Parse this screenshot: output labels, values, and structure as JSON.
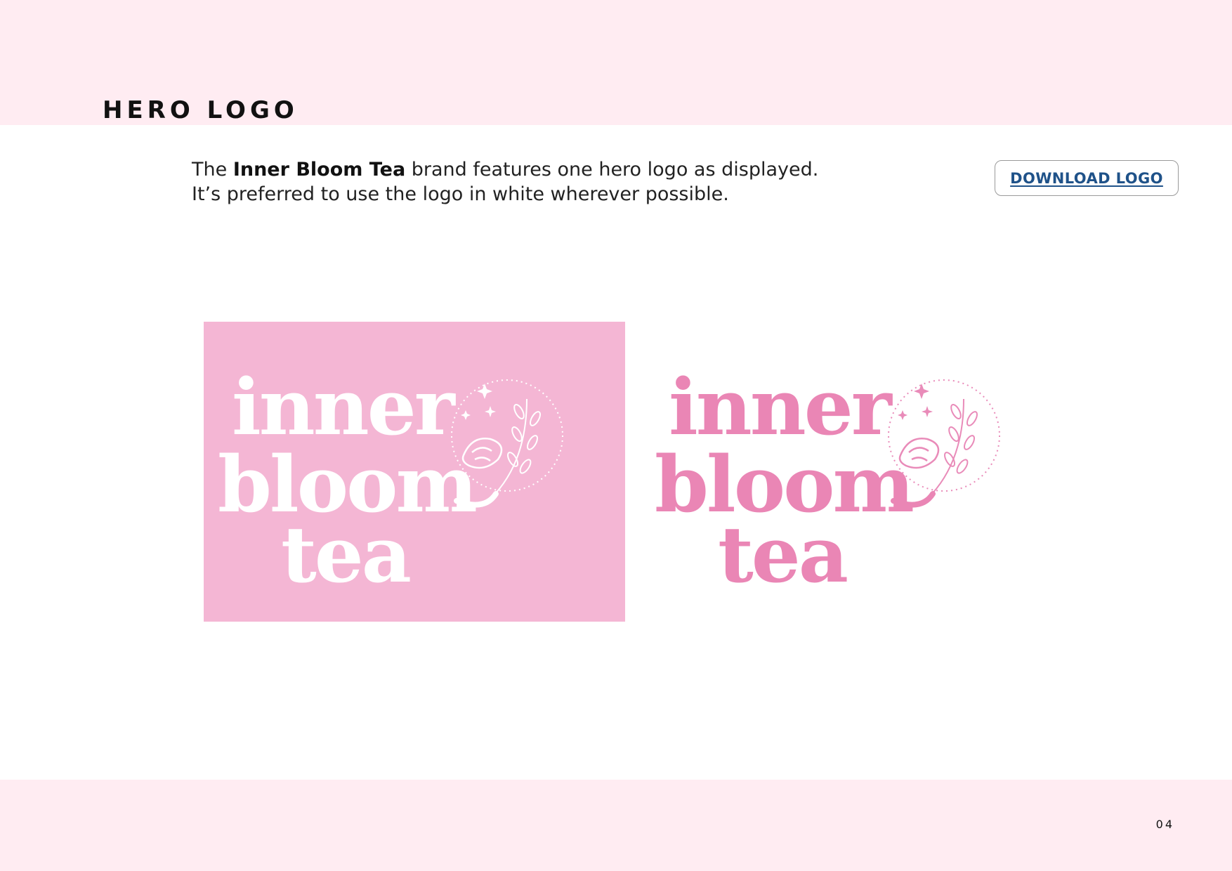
{
  "page": {
    "title": "HERO LOGO",
    "number": "04"
  },
  "intro": {
    "prefix": "The ",
    "brand": "Inner Bloom Tea",
    "line1_rest": " brand features one hero logo as displayed.",
    "line2": "It’s preferred to use the logo in white wherever possible."
  },
  "download": {
    "label": "DOWNLOAD LOGO"
  },
  "logo": {
    "words": [
      "inner",
      "bloom",
      "tea"
    ],
    "icons": [
      "moon-icon",
      "flower-icon",
      "leaf-sprig-icon",
      "sparkle-icon"
    ],
    "variants": [
      {
        "name": "white-on-pink",
        "background": "#f4b6d4",
        "foreground": "#ffffff",
        "accent": "#e98bb9"
      },
      {
        "name": "pink-on-white",
        "background": "#ffffff",
        "foreground": "#ea86b5",
        "accent": "#e98bb9"
      }
    ]
  },
  "colors": {
    "band": "#ffecf2",
    "card": "#f4b6d4",
    "logo_pink": "#ea86b5",
    "link": "#1f5289"
  }
}
